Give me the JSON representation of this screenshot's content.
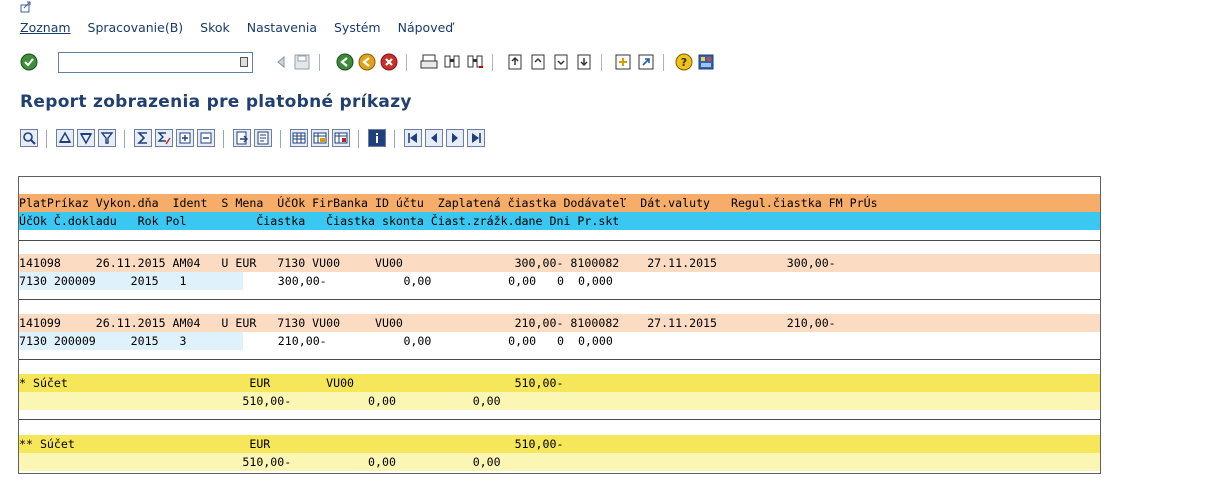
{
  "menubar": {
    "items": [
      "Zoznam",
      "Spracovanie(B)",
      "Skok",
      "Nastavenia",
      "Systém",
      "Nápoveď"
    ]
  },
  "toolbar": {
    "command_field_value": ""
  },
  "page": {
    "title": "Report zobrazenia pre platobné príkazy"
  },
  "colors": {
    "header1": "#f7ad6a",
    "header2": "#3ac8f2",
    "row1": "#fbdcc2",
    "row2": "#dff1fa",
    "total1": "#f6e65a",
    "total2": "#fbf6b4"
  },
  "grid": {
    "header1": "PlatPríkaz Vykon.dňa  Ident  S Mena  ÚčOk FirBanka ID účtu  Zaplatená čiastka Dodávateľ  Dát.valuty   Regul.čiastka FM PrÚs",
    "header2": "ÚčOk Č.dokladu   Rok Pol          Čiastka   Čiastka skonta Čiast.zrážk.dane Dni Pr.skt",
    "records": [
      {
        "line1": "141098     26.11.2015 AM04   U EUR   7130 VU00     VU00                300,00- 8100082    27.11.2015          300,00-",
        "line2_key": "7130 200009     2015   1",
        "line2_rest": "          300,00-           0,00           0,00   0  0,000"
      },
      {
        "line1": "141099     26.11.2015 AM04   U EUR   7130 VU00     VU00                210,00- 8100082    27.11.2015          210,00-",
        "line2_key": "7130 200009     2015   3",
        "line2_rest": "          210,00-           0,00           0,00   0  0,000"
      }
    ],
    "totals": [
      {
        "line1": "* Súčet                          EUR        VU00                       510,00-",
        "line2": "                                510,00-           0,00           0,00"
      },
      {
        "line1": "** Súčet                         EUR                                   510,00-",
        "line2": "                                510,00-           0,00           0,00"
      }
    ]
  }
}
